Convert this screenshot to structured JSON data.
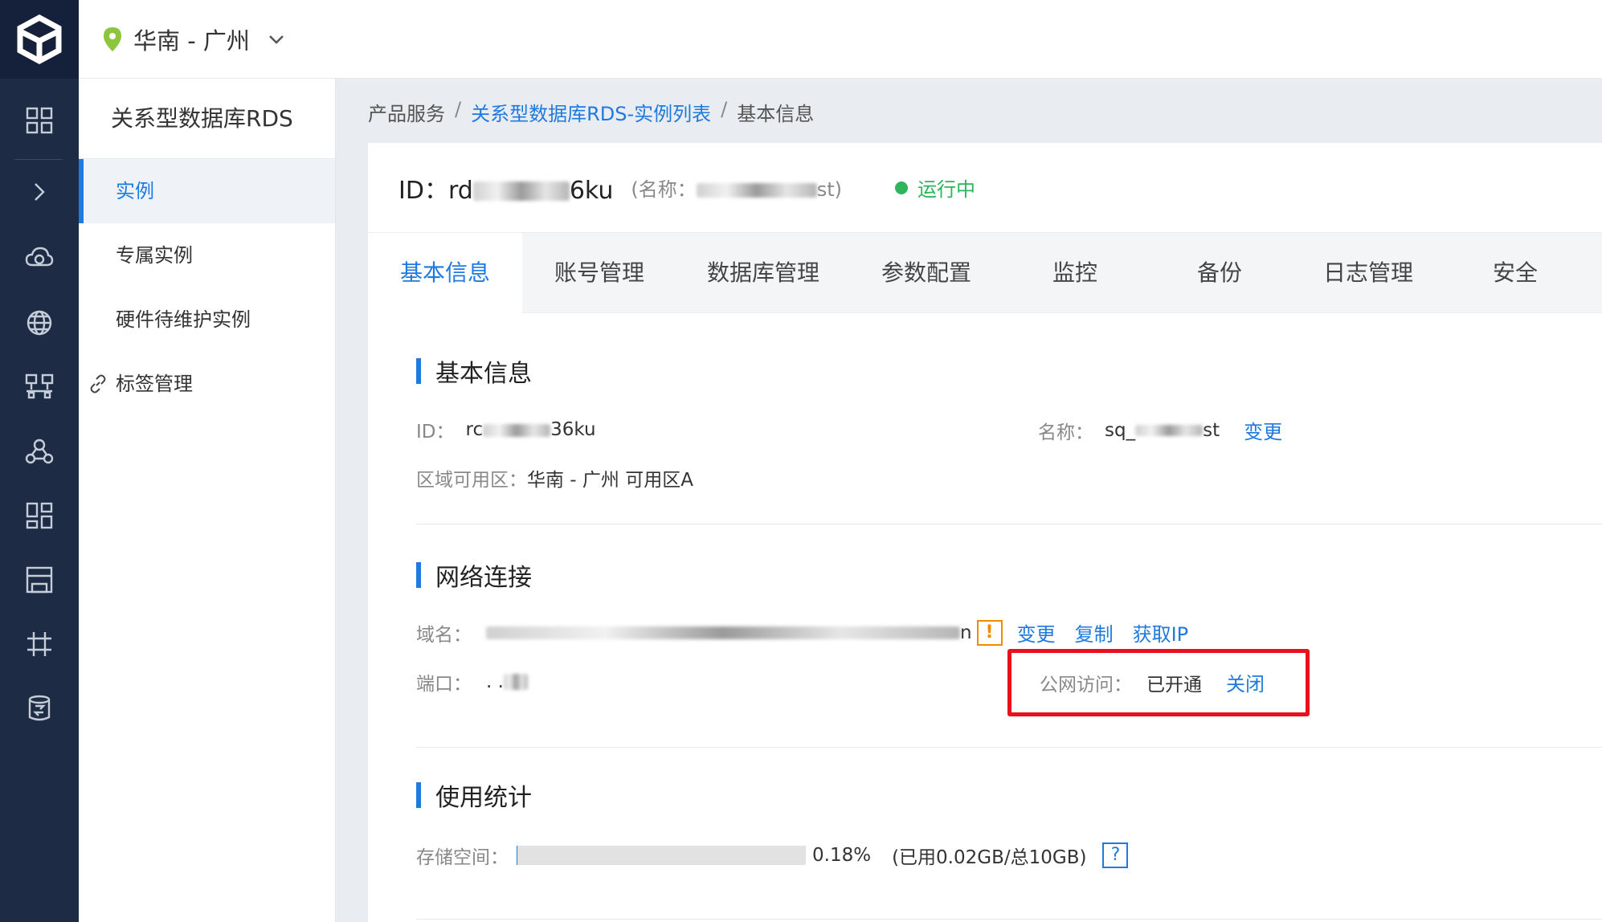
{
  "header": {
    "region": "华南 - 广州"
  },
  "subnav": {
    "title": "关系型数据库RDS",
    "items": [
      {
        "label": "实例"
      },
      {
        "label": "专属实例"
      },
      {
        "label": "硬件待维护实例"
      },
      {
        "label": "标签管理"
      }
    ]
  },
  "breadcrumb": {
    "root": "产品服务",
    "sep": "/",
    "list": "关系型数据库RDS-实例列表",
    "current": "基本信息"
  },
  "instance": {
    "id_prefix": "ID：rd",
    "id_suffix": "6ku",
    "name_prefix": "(名称：",
    "name_suffix": "st)",
    "status": "运行中"
  },
  "tabs": [
    "基本信息",
    "账号管理",
    "数据库管理",
    "参数配置",
    "监控",
    "备份",
    "日志管理",
    "安全"
  ],
  "basic": {
    "title": "基本信息",
    "id_label": "ID：",
    "id_prefix": "rc",
    "id_suffix": "36ku",
    "name_label": "名称：",
    "name_prefix": "sq_",
    "name_suffix": "st",
    "name_change": "变更",
    "zone_label": "区域可用区：",
    "zone_value": "华南 - 广州 可用区A"
  },
  "network": {
    "title": "网络连接",
    "domain_label": "域名：",
    "domain_suffix": "n",
    "warn": "!",
    "change": "变更",
    "copy": "复制",
    "get_ip": "获取IP",
    "port_label": "端口：",
    "port_prefix": ". .",
    "public_label": "公网访问：",
    "public_value": "已开通",
    "public_close": "关闭"
  },
  "usage": {
    "title": "使用统计",
    "storage_label": "存储空间：",
    "storage_percent": "0.18%",
    "storage_detail": "(已用0.02GB/总10GB)",
    "storage_fraction": 0.0018,
    "help": "?"
  },
  "colors": {
    "accent": "#1f7ae0",
    "running": "#2db55d",
    "highlight": "#e8101a",
    "rail": "#1d2b44"
  }
}
